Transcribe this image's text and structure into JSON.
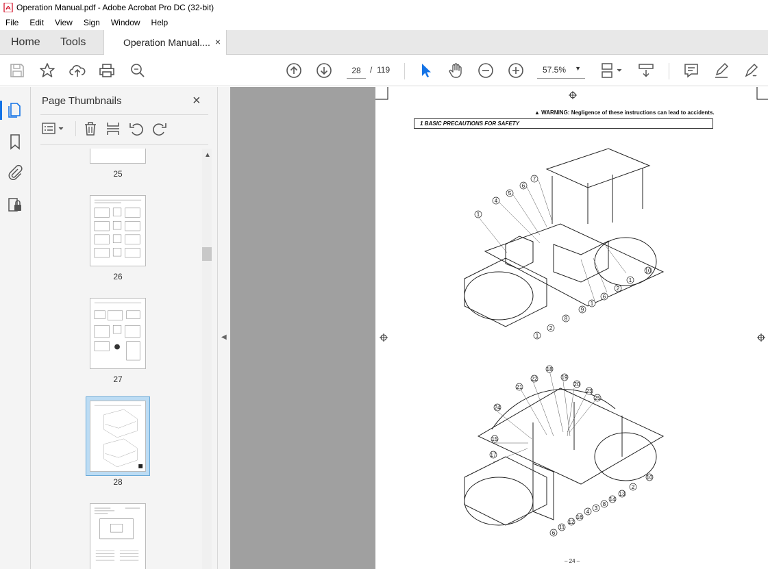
{
  "window": {
    "title": "Operation Manual.pdf - Adobe Acrobat Pro DC (32-bit)"
  },
  "menu": [
    "File",
    "Edit",
    "View",
    "Sign",
    "Window",
    "Help"
  ],
  "tabs": {
    "home": "Home",
    "tools": "Tools",
    "document": "Operation Manual....",
    "close": "×"
  },
  "toolbar": {
    "current_page": "28",
    "page_separator": "/",
    "total_pages": "119",
    "zoom": "57.5%",
    "accent_color": "#1473e6"
  },
  "thumbnail_panel": {
    "title": "Page Thumbnails",
    "close": "×",
    "pages": [
      "25",
      "26",
      "27",
      "28"
    ],
    "selected_page": "28"
  },
  "document": {
    "warning": "▲ WARNING: Negligence of these instructions can lead to accidents.",
    "section_heading": "1  BASIC PRECAUTIONS FOR SAFETY",
    "page_footer": "– 24 –",
    "top_callouts": [
      "1",
      "4",
      "5",
      "6",
      "7",
      "10",
      "1",
      "2",
      "6",
      "1",
      "9",
      "8",
      "2",
      "1"
    ],
    "bottom_callouts": [
      "18",
      "19",
      "20",
      "21",
      "22",
      "23",
      "25",
      "24",
      "15",
      "17",
      "10",
      "2",
      "13",
      "14",
      "8",
      "3",
      "4",
      "16",
      "12",
      "11",
      "6"
    ]
  }
}
